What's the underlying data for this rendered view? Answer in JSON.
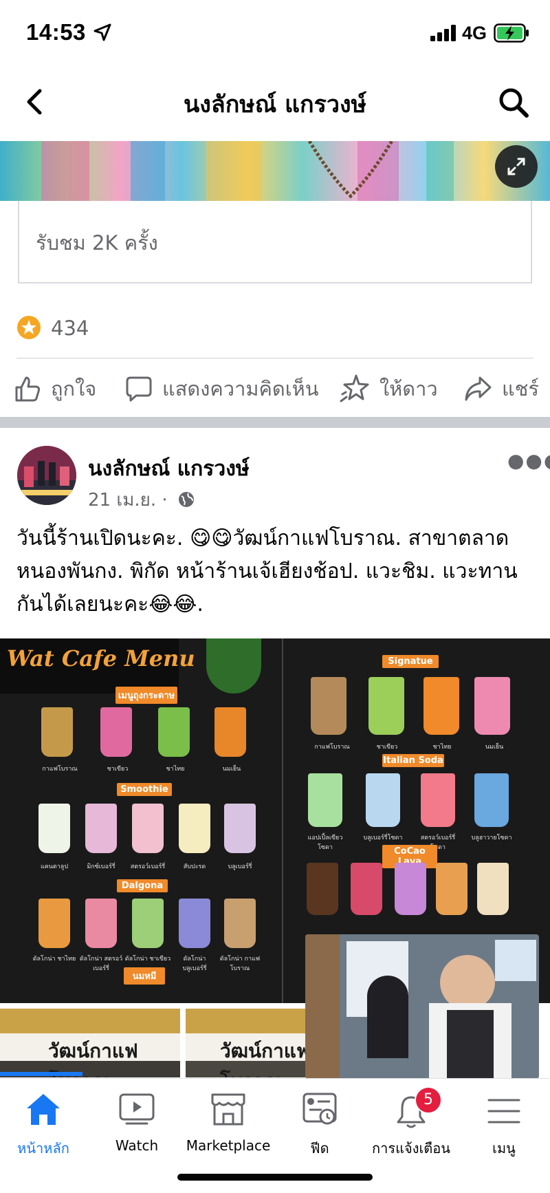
{
  "status_bar": {
    "time": "14:53",
    "network": "4G"
  },
  "header": {
    "title": "นงลักษณ์ แกรวงษ์"
  },
  "video_card": {
    "views": "รับชม 2K ครั้ง"
  },
  "stars": {
    "count": "434"
  },
  "actions": {
    "like": "ถูกใจ",
    "comment": "แสดงความคิดเห็น",
    "star": "ให้ดาว",
    "share": "แชร์"
  },
  "post": {
    "author": "นงลักษณ์ แกรวงษ์",
    "date": "21 เม.ย. ·",
    "lines": [
      "วันนี้ร้านเปิดนะคะ. 😋😋วัฒน์กาแฟโบราณ. สาขาตลาด",
      "หนองพันกง. พิกัด หน้าร้านเจ้เฮียงช้อป. แวะชิม. แวะทาน",
      "กันได้เลยนะคะ😂😂."
    ]
  },
  "menu_image": {
    "brand": "Wat Cafe Menu",
    "sec_ice": "เมนูถุงกระดาษ",
    "sec_smoothie": "Smoothie",
    "sec_dalgona": "Dalgona",
    "sec_nom": "นมหมี",
    "sec_signature": "Signatue",
    "sec_soda": "Italian Soda",
    "sec_cocoa": "CoCao Lava",
    "cap_ice": [
      "กาแฟโบราณ",
      "ชาเขียว",
      "ชาไทย",
      "นมเย็น"
    ],
    "cap_smoothie": [
      "แคนตาลูป",
      "มิกซ์เบอร์รี่",
      "สตรอว์เบอร์รี่",
      "สับปะรด",
      "บลูเบอร์รี่"
    ],
    "cap_dalgona": [
      "ดัลโกน่า ชาไทย",
      "ดัลโกน่า สตรอว์เบอร์รี่",
      "ดัลโกน่า ชาเขียว",
      "ดัลโกน่า บลูเบอร์รี่",
      "ดัลโกน่า กาแฟโบราณ"
    ],
    "cap_sig": [
      "กาแฟโบราณ",
      "ชาเขียว",
      "ชาไทย",
      "นมเย็น"
    ],
    "cap_soda": [
      "แอปเปิ้ลเขียวโซดา",
      "บลูเบอร์รี่โซดา",
      "สตรอว์เบอร์รี่โซดา",
      "บลูฮาวายโซดา"
    ]
  },
  "store_sign": {
    "name": "วัฒน์กาแฟโบราณ"
  },
  "tabs": {
    "home": "หน้าหลัก",
    "watch": "Watch",
    "marketplace": "Marketplace",
    "feed": "ฟีด",
    "notifications": "การแจ้งเตือน",
    "menu": "เมนู",
    "notif_badge": "5"
  },
  "colors": {
    "accent": "#1877f2",
    "badge": "#e41e3f",
    "star": "#f5a623"
  }
}
